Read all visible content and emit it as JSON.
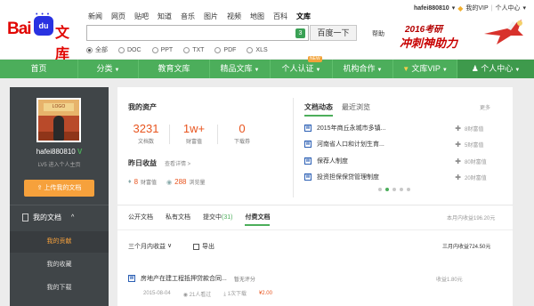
{
  "logo": {
    "text_bai": "Bai",
    "text_du": "du",
    "text_wk": "文库"
  },
  "nav": [
    "新闻",
    "网页",
    "贴吧",
    "知道",
    "音乐",
    "图片",
    "视频",
    "地图",
    "百科",
    "文库"
  ],
  "search": {
    "value": "",
    "badge": "3",
    "button": "百度一下",
    "help": "帮助"
  },
  "filters": [
    {
      "label": "全部",
      "selected": true
    },
    {
      "label": "DOC",
      "selected": false
    },
    {
      "label": "PPT",
      "selected": false
    },
    {
      "label": "TXT",
      "selected": false
    },
    {
      "label": "PDF",
      "selected": false
    },
    {
      "label": "XLS",
      "selected": false
    }
  ],
  "userbar": {
    "username": "hafei880810",
    "vip": "我的VIP",
    "sep": "|",
    "center": "个人中心"
  },
  "banner": {
    "year": "2016考研",
    "headline": "冲刺神助力"
  },
  "menu": [
    {
      "label": "首页",
      "caret": ""
    },
    {
      "label": "分类",
      "caret": "▼"
    },
    {
      "label": "教育文库",
      "caret": ""
    },
    {
      "label": "精品文库",
      "caret": "▼"
    },
    {
      "label": "个人认证",
      "caret": "▼",
      "badge": "NEW"
    },
    {
      "label": "机构合作",
      "caret": "▼"
    },
    {
      "label": "文库VIP",
      "caret": "▼"
    },
    {
      "label": "个人中心",
      "caret": "▼"
    }
  ],
  "sidebar": {
    "avatar_sign": "LOGO",
    "username": "hafei880810",
    "verified": "V",
    "level": "LV5",
    "home_link": "进入个人主页",
    "upload": "上传我的文档",
    "mydocs": "我的文档",
    "mydocs_chevron": "^",
    "items": [
      "我的贡献",
      "我的收藏",
      "我的下载"
    ]
  },
  "assets": {
    "title": "我的资产",
    "stats": [
      {
        "value": "3231",
        "label": "文档数"
      },
      {
        "value": "1w+",
        "label": "财富值"
      },
      {
        "value": "0",
        "label": "下载券"
      }
    ]
  },
  "yesterday": {
    "title": "昨日收益",
    "link": "查看详情 >",
    "wealth_value": "8",
    "wealth_label": "财富值",
    "views_value": "288",
    "views_label": "浏览量"
  },
  "dynamics": {
    "tabs": [
      "文档动态",
      "最近浏览"
    ],
    "more": "更多",
    "items": [
      {
        "title": "2015年商丘永城市多镇...",
        "value": "8财富值"
      },
      {
        "title": "河南省人口和计划生育...",
        "value": "5财富值"
      },
      {
        "title": "保荐人制度",
        "value": "80财富值"
      },
      {
        "title": "投资担保保贷管理制度",
        "value": "20财富值"
      }
    ]
  },
  "doc_tabs": {
    "tabs": [
      {
        "label": "公开文档",
        "count": ""
      },
      {
        "label": "私有文档",
        "count": ""
      },
      {
        "label": "提交中",
        "count": "(31)"
      },
      {
        "label": "付费文档",
        "count": ""
      }
    ],
    "month_income": "本月内收益196.20元"
  },
  "toolbar": {
    "period": "三个月内收益",
    "period_caret": "∨",
    "export": "导出",
    "three_month_income": "三月内收益724.50元"
  },
  "paid_doc": {
    "title": "房地产在建工程抵押贷款合同...",
    "score": "暂无评分",
    "income": "收益1.80元",
    "date": "2015-08-04",
    "views": "21人看过",
    "downloads": "1次下载",
    "price": "¥2.00"
  },
  "colors": {
    "accent_green": "#4cae5b",
    "brand_red": "#e10602",
    "orange": "#f6a13c",
    "sidebar": "#404548"
  }
}
